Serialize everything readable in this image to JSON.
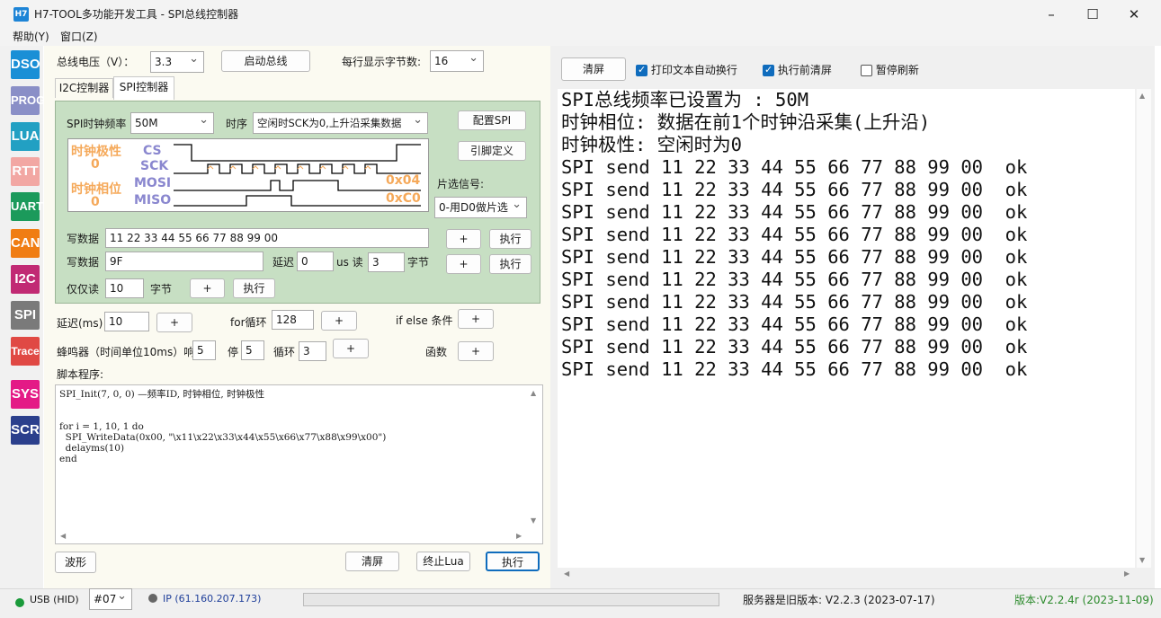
{
  "window": {
    "icon_text": "H7",
    "title": "H7-TOOL多功能开发工具 - SPI总线控制器"
  },
  "menu": [
    "帮助(Y)",
    "窗口(Z)"
  ],
  "toolbar": [
    {
      "label": "DSO",
      "color": "#1a8fd6"
    },
    {
      "label": "PROG",
      "color": "#8a8fc7"
    },
    {
      "label": "LUA",
      "color": "#22a0c3"
    },
    {
      "label": "RTT",
      "color": "#f2a7a3"
    },
    {
      "label": "UART",
      "color": "#1b9a5b"
    },
    {
      "label": "CAN",
      "color": "#f07d13"
    },
    {
      "label": "I2C",
      "color": "#c12a74"
    },
    {
      "label": "SPI",
      "color": "#7a7a7a"
    },
    {
      "label": "Trace",
      "color": "#e04944"
    },
    {
      "label": "SYS",
      "color": "#e41a86"
    },
    {
      "label": "SCR",
      "color": "#2b3f8c"
    }
  ],
  "top": {
    "voltage_label": "总线电压（V）：",
    "voltage_value": "3.3",
    "start_bus": "启动总线",
    "bytes_label": "每行显示字节数:",
    "bytes_value": "16"
  },
  "tabs": [
    "I2C控制器",
    "SPI控制器"
  ],
  "spi": {
    "freq_label": "SPI时钟频率",
    "freq_value": "50M",
    "timing_label": "时序",
    "timing_value": "空闲时SCK为0,上升沿采集数据",
    "config_btn": "配置SPI",
    "pin_btn": "引脚定义",
    "cs_label": "片选信号:",
    "cs_value": "0-用D0做片选",
    "wave": {
      "cpol_label": "时钟极性",
      "cpol_value": "0",
      "cpha_label": "时钟相位",
      "cpha_value": "0",
      "cs": "CS",
      "sck": "SCK",
      "mosi": "MOSI",
      "miso": "MISO",
      "mosi_val": "0x04",
      "miso_val": "0xC0"
    },
    "write1_label": "写数据",
    "write1_value": "11 22 33 44 55 66 77 88 99 00",
    "write2_label": "写数据",
    "write2_value": "9F",
    "delay_label": "延迟",
    "delay_value": "0",
    "us_read_label": "us 读",
    "read_value": "3",
    "bytes_unit": "字节",
    "readonly_label": "仅仅读",
    "readonly_value": "10",
    "readonly_unit": "字节",
    "plus": "+",
    "exec": "执行"
  },
  "script_tools": {
    "delay_label": "延迟(ms)",
    "delay_value": "10",
    "for_label": "for循环",
    "for_value": "128",
    "ifelse_label": "if else 条件",
    "beep_label": "蜂鸣器（时间单位10ms）响",
    "beep_on": "5",
    "beep_off_label": "停",
    "beep_off": "5",
    "loop_label": "循环",
    "loop_value": "3",
    "func_label": "函数",
    "plus": "+"
  },
  "script": {
    "label": "脚本程序:",
    "lines": [
      "SPI_Init(7, 0, 0) —频率ID, 时钟相位, 时钟极性",
      "",
      "",
      "for i = 1, 10, 1 do",
      "  SPI_WriteData(0x00, \"\\x11\\x22\\x33\\x44\\x55\\x66\\x77\\x88\\x99\\x00\")",
      "  delayms(10)",
      "end"
    ]
  },
  "bottom_buttons": {
    "wave": "波形",
    "clear": "清屏",
    "stop": "终止Lua",
    "run": "执行"
  },
  "console_toolbar": {
    "clear": "清屏",
    "wrap_label": "打印文本自动换行",
    "wrap_checked": true,
    "preclear_label": "执行前清屏",
    "preclear_checked": true,
    "pause_label": "暂停刷新",
    "pause_checked": false
  },
  "console": [
    "SPI总线频率已设置为 : 50M",
    "时钟相位: 数据在前1个时钟沿采集(上升沿)",
    "时钟极性: 空闲时为0",
    "SPI send 11 22 33 44 55 66 77 88 99 00  ok",
    "SPI send 11 22 33 44 55 66 77 88 99 00  ok",
    "SPI send 11 22 33 44 55 66 77 88 99 00  ok",
    "SPI send 11 22 33 44 55 66 77 88 99 00  ok",
    "SPI send 11 22 33 44 55 66 77 88 99 00  ok",
    "SPI send 11 22 33 44 55 66 77 88 99 00  ok",
    "SPI send 11 22 33 44 55 66 77 88 99 00  ok",
    "SPI send 11 22 33 44 55 66 77 88 99 00  ok",
    "SPI send 11 22 33 44 55 66 77 88 99 00  ok",
    "SPI send 11 22 33 44 55 66 77 88 99 00  ok"
  ],
  "status": {
    "usb": "USB (HID)",
    "device": "#07",
    "ip": "IP (61.160.207.173)",
    "server": "服务器是旧版本: V2.2.3 (2023-07-17)",
    "version": "版本:V2.2.4r (2023-11-09)",
    "usb_color": "#1a9a3a",
    "version_color": "#2b8a2b"
  }
}
